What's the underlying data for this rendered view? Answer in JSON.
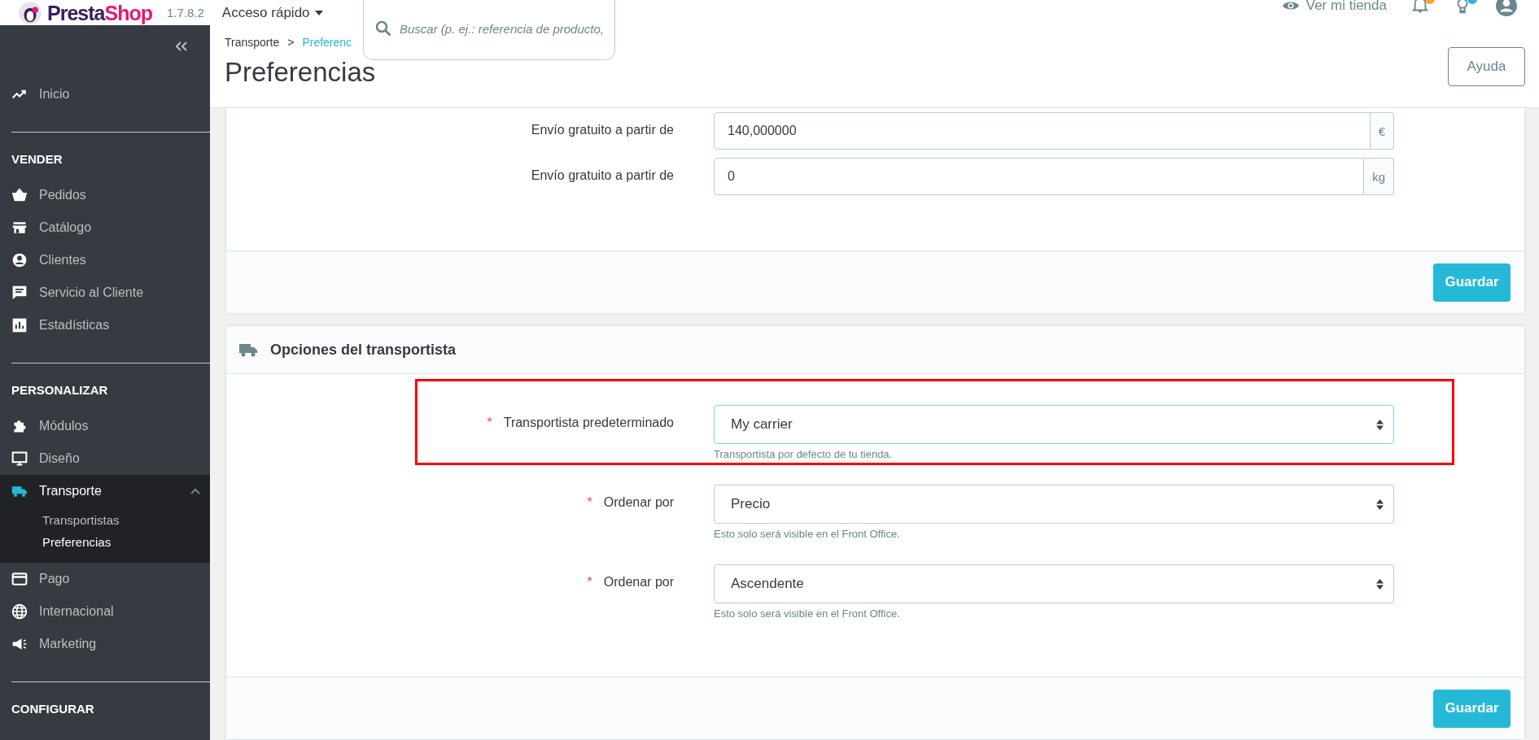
{
  "topbar": {
    "logo": [
      "Presta",
      "Shop"
    ],
    "version": "1.7.8.2",
    "quick_access": "Acceso rápido",
    "search": {
      "placeholder": "Buscar (p. ej.: referencia de producto,"
    },
    "view_store": "Ver mi tienda",
    "notification_badges": [
      {
        "color": "#f5a623"
      },
      {
        "color": "#25b9d7"
      }
    ]
  },
  "sidebar": {
    "sections": [
      {
        "items": [
          {
            "label": "Inicio",
            "selected": false,
            "expanded": false
          }
        ]
      },
      {
        "title": "VENDER",
        "items": [
          {
            "label": "Pedidos",
            "selected": false,
            "expanded": false
          },
          {
            "label": "Catálogo",
            "selected": false,
            "expanded": false
          },
          {
            "label": "Clientes",
            "selected": false,
            "expanded": false
          },
          {
            "label": "Servicio al Cliente",
            "selected": false,
            "expanded": false
          },
          {
            "label": "Estadísticas",
            "selected": false,
            "expanded": false
          }
        ]
      },
      {
        "title": "PERSONALIZAR",
        "items": [
          {
            "label": "Módulos",
            "selected": false,
            "expanded": false
          },
          {
            "label": "Diseño",
            "selected": false,
            "expanded": false
          },
          {
            "label": "Transporte",
            "selected": true,
            "expanded": true,
            "children": [
              {
                "label": "Transportistas",
                "selected": false
              },
              {
                "label": "Preferencias",
                "selected": true
              }
            ]
          },
          {
            "label": "Pago",
            "selected": false,
            "expanded": false
          },
          {
            "label": "Internacional",
            "selected": false,
            "expanded": false
          },
          {
            "label": "Marketing",
            "selected": false,
            "expanded": false
          }
        ]
      },
      {
        "title": "CONFIGURAR"
      }
    ]
  },
  "header": {
    "breadcrumb": [
      "Transporte",
      ">",
      "Preferenc"
    ],
    "title": "Preferencias",
    "help_button": "Ayuda"
  },
  "panels": [
    {
      "rows": [
        {
          "kind": "input",
          "label": "Envío gratuito a partir de",
          "value": "140,000000",
          "unit": "€",
          "highlighted": false
        },
        {
          "kind": "input",
          "label": "Envío gratuito a partir de",
          "value": "0",
          "unit": "kg",
          "highlighted": false
        }
      ],
      "save_button": "Guardar"
    },
    {
      "title": "Opciones del transportista",
      "rows": [
        {
          "kind": "select",
          "required_mark": "*",
          "label": "Transportista predeterminado",
          "value": "My carrier",
          "hint": "Transportista por defecto de tu tienda.",
          "highlighted": true,
          "focused": true
        },
        {
          "kind": "select",
          "required_mark": "*",
          "label": "Ordenar por",
          "value": "Precio",
          "hint": "Esto solo será visible en el Front Office.",
          "highlighted": false,
          "focused": false
        },
        {
          "kind": "select",
          "required_mark": "*",
          "label": "Ordenar por",
          "value": "Ascendente",
          "hint": "Esto solo será visible en el Front Office.",
          "highlighted": false,
          "focused": false
        }
      ],
      "save_button": "Guardar"
    }
  ]
}
